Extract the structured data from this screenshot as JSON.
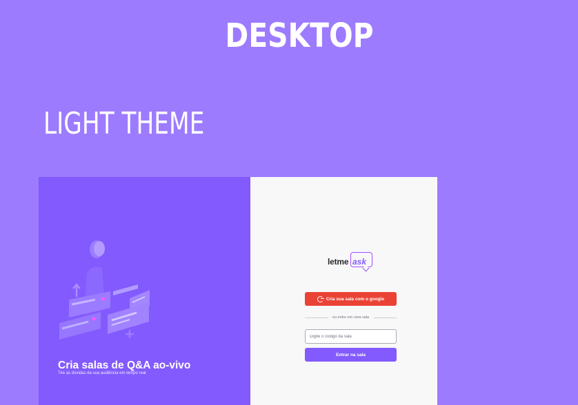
{
  "page": {
    "heading": "DESKTOP",
    "subheading": "LIGHT THEME"
  },
  "aside": {
    "title": "Cria salas de Q&A ao-vivo",
    "subtitle": "Tire as dúvidas da sua audiência em tempo real",
    "illustration_icon": "illustration-qa-icon"
  },
  "main": {
    "logo": {
      "part1": "letme",
      "part2": "ask"
    },
    "google_button_label": "Cria sua sala com o google",
    "google_icon": "google-icon",
    "separator_text": "ou entre em uma sala",
    "room_input_placeholder": "Digite o código da sala",
    "room_input_value": "",
    "enter_button_label": "Entrar na sala"
  },
  "colors": {
    "background": "#9d7bff",
    "brand": "#835afd",
    "google": "#ea4335",
    "surface": "#f8f8f8"
  }
}
